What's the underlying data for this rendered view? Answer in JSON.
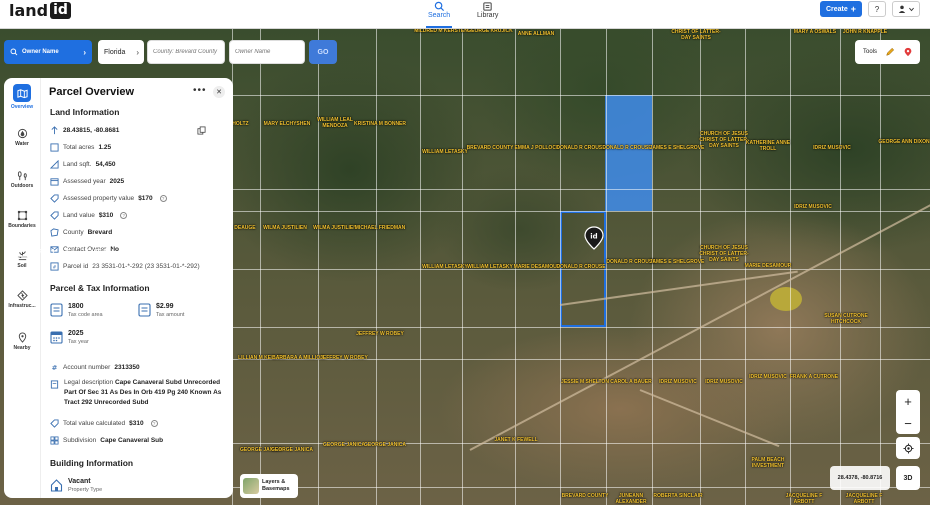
{
  "app": {
    "logo_text": "land",
    "logo_badge": "id"
  },
  "nav": {
    "search_label": "Search",
    "library_label": "Library"
  },
  "header": {
    "create_label": "Create",
    "help_label": "?"
  },
  "search": {
    "mode_label": "Owner Name",
    "state_value": "Florida",
    "county_placeholder": "County: Brevard County",
    "owner_placeholder": "Owner Name",
    "go_label": "GO"
  },
  "tools": {
    "label": "Tools"
  },
  "rail": [
    {
      "label": "Overview",
      "icon": "map-icon"
    },
    {
      "label": "Water",
      "icon": "water-icon"
    },
    {
      "label": "Outdoors",
      "icon": "outdoors-icon"
    },
    {
      "label": "Boundaries",
      "icon": "boundaries-icon"
    },
    {
      "label": "Soil",
      "icon": "soil-icon"
    },
    {
      "label": "Infrastruc...",
      "icon": "infrastructure-icon"
    },
    {
      "label": "Nearby",
      "icon": "nearby-icon"
    }
  ],
  "panel": {
    "title": "Parcel Overview",
    "more": "•••",
    "land_info_title": "Land Information",
    "coordinates": "28.43815, -80.8681",
    "total_acres": {
      "label": "Total acres",
      "value": "1.25"
    },
    "land_sqft": {
      "label": "Land sqft.",
      "value": "54,450"
    },
    "assessed_year": {
      "label": "Assessed year",
      "value": "2025"
    },
    "assessed_value": {
      "label": "Assessed property value",
      "value": "$170"
    },
    "land_value": {
      "label": "Land value",
      "value": "$310"
    },
    "county": {
      "label": "County",
      "value": "Brevard"
    },
    "contact_owner": {
      "label": "Contact Owner",
      "value": "No"
    },
    "parcel_id": {
      "label": "Parcel id",
      "value": "23 3531-01-*-292 (23 3531-01-*-292)"
    },
    "tax_title": "Parcel & Tax Information",
    "tax_code": {
      "value": "1800",
      "caption": "Tax code area"
    },
    "tax_amount": {
      "value": "$2.99",
      "caption": "Tax amount"
    },
    "tax_year": {
      "value": "2025",
      "caption": "Tax year"
    },
    "account_number": {
      "label": "Account number",
      "value": "2313350"
    },
    "legal_description": {
      "label": "Legal description",
      "value": "Cape Canaveral Subd Unrecorded Part Of Sec 31 As Des In Orb 419 Pg 240 Known As Tract 292 Unrecorded Subd"
    },
    "total_value_calc": {
      "label": "Total value calculated",
      "value": "$310"
    },
    "subdivision": {
      "label": "Subdivision",
      "value": "Cape Canaveral Sub"
    },
    "building_title": "Building Information",
    "property_type": {
      "value": "Vacant",
      "caption": "Property Type"
    }
  },
  "watermark": "A12071145 - SEFMLS© 2026",
  "layers": {
    "label_line1": "Layers &",
    "label_line2": "Basemaps"
  },
  "zoom": {
    "plus": "+",
    "minus": "−"
  },
  "coords_readout": "28.4378, -80.8716",
  "btn_3d": "3D",
  "parcel_labels": [
    "MILDRED M KERSTEN",
    "GEORGE KRUJICK",
    "ANNE ALLMAN",
    "CHRIST OF LATTER-DAY SAINTS",
    "MARY A OSWALS",
    "JOHN R KNAPPLE",
    "ABEL HOLTZ",
    "MARY ELCHYSHEN",
    "WILLIAM LEAL MENDOZA",
    "KRISTINA M BONNER",
    "WILLIAM LETASKY",
    "BREVARD COUNTY",
    "EMMA J POLLOCK",
    "DONALD R CROUSE",
    "DONALD R CROUSE",
    "JAMES E SHELGROVE",
    "CHURCH OF JESUS CHRIST OF LATTER-DAY SAINTS",
    "KATHERINE ANNE TROLL",
    "IDRIZ MUSOVIC",
    "GEORGE ANN DIXON",
    "IDRIZ MUSOVIC",
    "LUZETTE DEAUGE",
    "WILMA JUSTILIEN",
    "WILMA JUSTILIEN",
    "MICHAEL FRIEDMAN",
    "WILLIAM LETASKY",
    "WILLIAM LETASKY",
    "MARIE DESAMOUR",
    "DONALD R CROUSE",
    "DONALD R CROUSE",
    "JAMES E SHELGROVE",
    "CHURCH OF JESUS CHRIST OF LATTER-DAY SAINTS",
    "MARIE DESAMOUR",
    "SUSAN CUTRONE HITCHCOCK",
    "JEFFREY W ROBEY",
    "LILLIAN M KELLEY",
    "BARBARA A MILLION",
    "JEFFREY W ROBEY",
    "IDRIZ MUSOVIC",
    "FRANK A CUTRONE",
    "JESSIE M SHELTON",
    "CAROL A BAUER",
    "IDRIZ MUSOVIC",
    "IDRIZ MUSOVIC",
    "JANET K FEWELL",
    "GEORGE JANICA",
    "GEORGE JANICA",
    "GEORGE JANICA",
    "GEORGE JANICA",
    "PALM BEACH INVESTMENT",
    "BREVARD COUNTY",
    "JUNEANN ALEXANDER",
    "ROBERTA SINCLAIR",
    "JACQUELINE F ARBOTT",
    "JACQUELINE F ARBOTT"
  ]
}
